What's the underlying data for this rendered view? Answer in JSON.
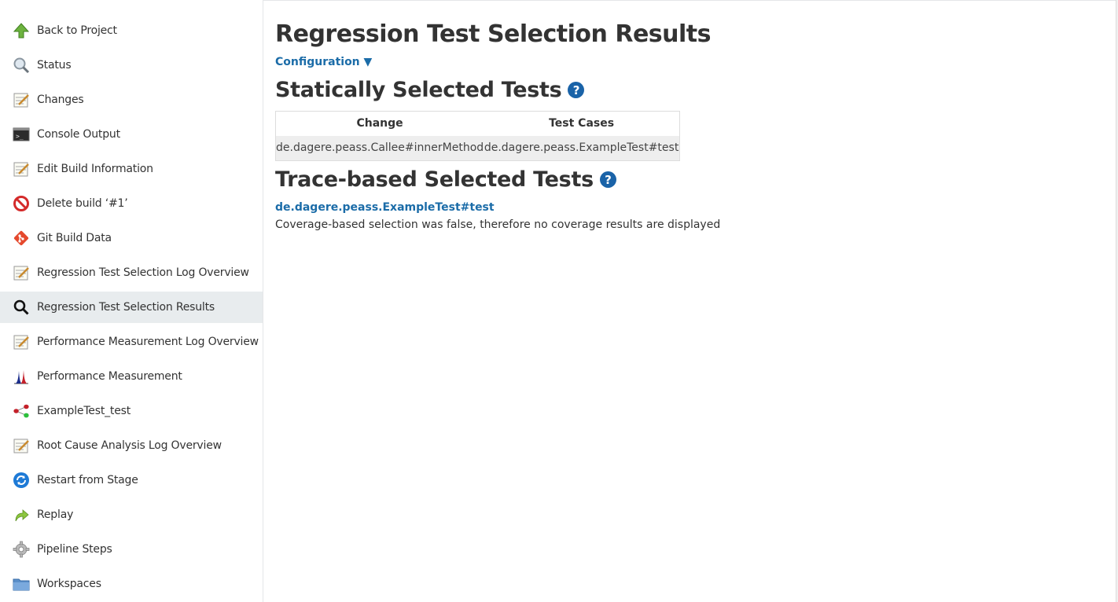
{
  "sidebar": {
    "items": [
      {
        "label": "Back to Project",
        "icon": "up-arrow-icon"
      },
      {
        "label": "Status",
        "icon": "magnifier-icon"
      },
      {
        "label": "Changes",
        "icon": "notepad-icon"
      },
      {
        "label": "Console Output",
        "icon": "terminal-icon"
      },
      {
        "label": "Edit Build Information",
        "icon": "notepad-icon"
      },
      {
        "label": "Delete build ‘#1’",
        "icon": "no-entry-icon"
      },
      {
        "label": "Git Build Data",
        "icon": "git-icon"
      },
      {
        "label": "Regression Test Selection Log Overview",
        "icon": "notepad-icon"
      },
      {
        "label": "Regression Test Selection Results",
        "icon": "search-icon"
      },
      {
        "label": "Performance Measurement Log Overview",
        "icon": "notepad-icon"
      },
      {
        "label": "Performance Measurement",
        "icon": "distribution-icon"
      },
      {
        "label": "ExampleTest_test",
        "icon": "graph-nodes-icon"
      },
      {
        "label": "Root Cause Analysis Log Overview",
        "icon": "notepad-icon"
      },
      {
        "label": "Restart from Stage",
        "icon": "restart-icon"
      },
      {
        "label": "Replay",
        "icon": "replay-arrow-icon"
      },
      {
        "label": "Pipeline Steps",
        "icon": "gear-icon"
      },
      {
        "label": "Workspaces",
        "icon": "folder-icon"
      }
    ],
    "active_index": 8
  },
  "main": {
    "title": "Regression Test Selection Results",
    "config_label": "Configuration ▼",
    "static_heading": "Statically Selected Tests",
    "table": {
      "headers": [
        "Change",
        "Test Cases"
      ],
      "rows": [
        [
          "de.dagere.peass.Callee#innerMethod",
          "de.dagere.peass.ExampleTest#test"
        ]
      ]
    },
    "trace_heading": "Trace-based Selected Tests",
    "trace_test": "de.dagere.peass.ExampleTest#test",
    "coverage_note": "Coverage-based selection was false, therefore no coverage results are displayed",
    "help_glyph": "?"
  },
  "colors": {
    "link": "#1b6ca8",
    "help": "#1a63a8",
    "active_bg": "#e8ecee"
  }
}
